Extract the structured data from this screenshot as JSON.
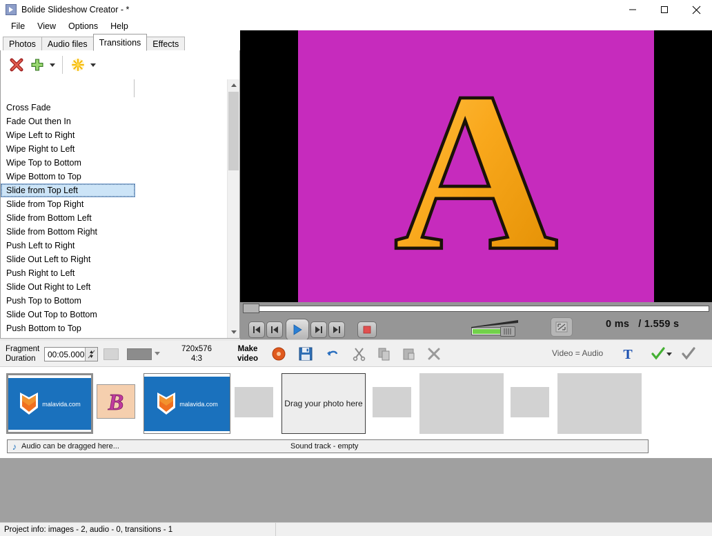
{
  "window": {
    "title": "Bolide Slideshow Creator - *",
    "app_icon": "play-triangle-icon",
    "minimize": "─",
    "maximize": "□",
    "close": "✕"
  },
  "menu": {
    "items": [
      {
        "label": "File"
      },
      {
        "label": "View"
      },
      {
        "label": "Options"
      },
      {
        "label": "Help"
      }
    ]
  },
  "tabs": [
    {
      "label": "Photos",
      "active": false
    },
    {
      "label": "Audio files",
      "active": false
    },
    {
      "label": "Transitions",
      "active": true
    },
    {
      "label": "Effects",
      "active": false
    }
  ],
  "panel_toolbar": {
    "delete_icon": "red-x-icon",
    "add_icon": "green-plus-icon",
    "add_caret": "chevron-down-icon",
    "random_icon": "yellow-starburst-icon",
    "random_caret": "chevron-down-icon"
  },
  "transitions": {
    "selected": "Slide from Top Left",
    "items": [
      "Cross Fade",
      "Fade Out then In",
      "Wipe Left to Right",
      "Wipe Right to Left",
      "Wipe Top to Bottom",
      "Wipe Bottom to Top",
      "Slide from Top Left",
      "Slide from Top Right",
      "Slide from Bottom Left",
      "Slide from Bottom Right",
      "Push Left to Right",
      "Slide Out Left to Right",
      "Push Right to Left",
      "Slide Out Right to Left",
      "Push Top to Bottom",
      "Slide Out Top to Bottom",
      "Push Bottom to Top"
    ]
  },
  "preview": {
    "letter": "A",
    "background_color": "#c62bbd",
    "letterbox_color": "#000000",
    "letter_color": "#f5a623"
  },
  "player": {
    "skip_start_icon": "skip-to-start-icon",
    "prev_icon": "previous-frame-icon",
    "play_icon": "play-icon",
    "next_icon": "next-frame-icon",
    "skip_end_icon": "skip-to-end-icon",
    "stop_icon": "stop-icon",
    "volume_icon": "volume-slider",
    "fullscreen_icon": "fullscreen-icon",
    "current_time": "0 ms",
    "total_time": "/ 1.559 s"
  },
  "bottom_toolbar": {
    "fragment_label_line1": "Fragment",
    "fragment_label_line2": "Duration",
    "duration_value": "00:05.000",
    "spinner_icon": "spinner-up-down-icon",
    "swatch_light": "#d4d4d4",
    "swatch_dark": "#8c8c8c",
    "swatch_caret": "chevron-down-icon",
    "resolution_line1": "720x576",
    "resolution_line2": "4:3",
    "make_video_line1": "Make",
    "make_video_line2": "video",
    "burn_icon": "burn-disc-icon",
    "save_icon": "save-floppy-icon",
    "undo_icon": "undo-arrow-icon",
    "redo_icon": "redo-arrow-icon",
    "cut_icon": "scissors-icon",
    "copy_icon": "copy-icon",
    "paste_icon": "paste-icon",
    "delete_icon": "delete-x-icon",
    "video_audio_label": "Video = Audio",
    "text_icon": "text-T-icon",
    "apply_icon": "green-check-icon",
    "apply_caret": "chevron-down-icon",
    "apply_all_icon": "gray-check-icon"
  },
  "filmstrip": {
    "slides": [
      {
        "type": "image",
        "label": "malavida.com",
        "selected": true
      },
      {
        "type": "transition",
        "letter": "B"
      },
      {
        "type": "image",
        "label": "malavida.com",
        "selected": false
      },
      {
        "type": "empty-small"
      },
      {
        "type": "drop-slot",
        "text": "Drag your photo here"
      },
      {
        "type": "empty-small"
      },
      {
        "type": "empty-large"
      },
      {
        "type": "empty-small"
      },
      {
        "type": "empty-large"
      }
    ]
  },
  "audio_track": {
    "note_icon": "music-note-icon",
    "drag_hint": "Audio can be dragged here...",
    "status": "Sound track - empty"
  },
  "status_bar": {
    "project_info": "Project info: images - 2, audio - 0, transitions - 1"
  }
}
